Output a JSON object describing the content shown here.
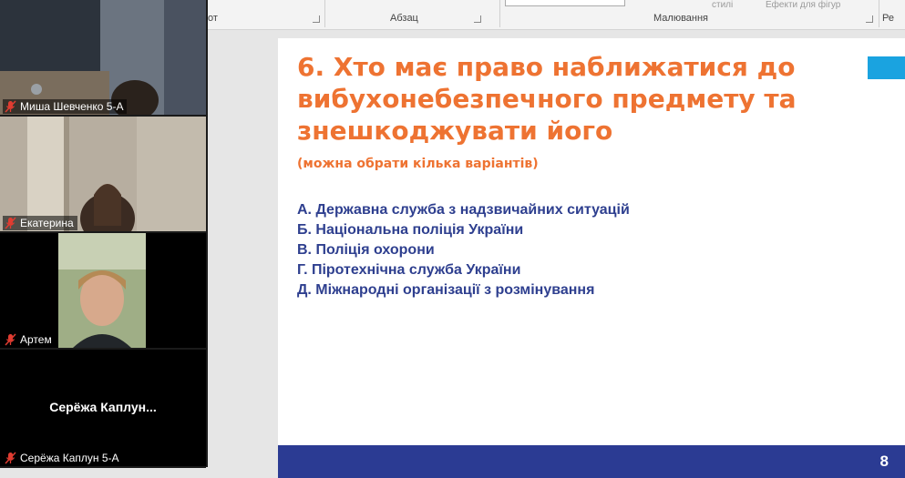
{
  "ribbon": {
    "groups": [
      {
        "label": "от"
      },
      {
        "label": "Абзац"
      },
      {
        "label": "Малювання"
      },
      {
        "label": "Ре"
      }
    ],
    "mini_labels": [
      "стилі",
      "Ефекти для фігур"
    ]
  },
  "participants": [
    {
      "name": "Миша Шевченко 5-А",
      "mic": "muted",
      "video": true
    },
    {
      "name": "Екатерина",
      "mic": "muted",
      "video": true
    },
    {
      "name": "Артем",
      "mic": "muted",
      "video": true
    },
    {
      "name": "Серёжа Каплун 5-А",
      "display_name": "Серёжа  Каплун...",
      "mic": "muted",
      "video": false
    }
  ],
  "slide": {
    "title": "6. Хто має право наближатися до вибухонебезпечного предмету та знешкоджувати його",
    "subtitle": "(можна обрати кілька варіантів)",
    "options": [
      "А. Державна служба  з надзвичайних ситуацій",
      "Б. Національна поліція України",
      "В. Поліція охорони",
      "Г.  Піротехнічна служба України",
      "Д. Міжнародні організації з розмінування"
    ],
    "page_number": "8"
  },
  "colors": {
    "title": "#ee7332",
    "options": "#2e3f8f",
    "footer": "#2b3b93",
    "accent": "#1aa3e0",
    "mic_muted": "#e03c31"
  }
}
